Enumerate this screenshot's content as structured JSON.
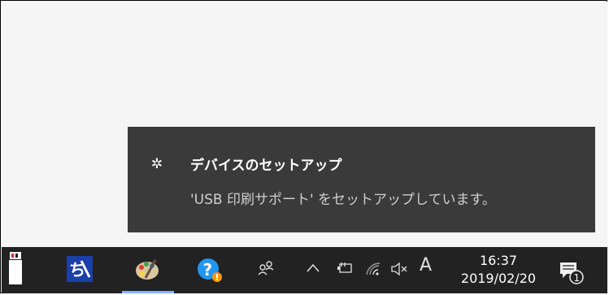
{
  "toast": {
    "icon": "gear-icon",
    "title": "デバイスのセットアップ",
    "message": "'USB 印刷サポート' をセットアップしています。"
  },
  "taskbar": {
    "pinned": [
      {
        "name": "paint-app-icon"
      },
      {
        "name": "ime-pad-icon"
      },
      {
        "name": "palette-icon"
      },
      {
        "name": "help-icon"
      }
    ],
    "tray": {
      "people_icon": "people-icon",
      "chevron_icon": "chevron-up-icon",
      "battery_icon": "battery-icon",
      "wifi_icon": "wifi-icon",
      "volume_icon": "volume-muted-icon",
      "ime_label": "A"
    },
    "clock": {
      "time": "16:37",
      "date": "2019/02/20"
    },
    "notifications": {
      "count": "1"
    }
  }
}
